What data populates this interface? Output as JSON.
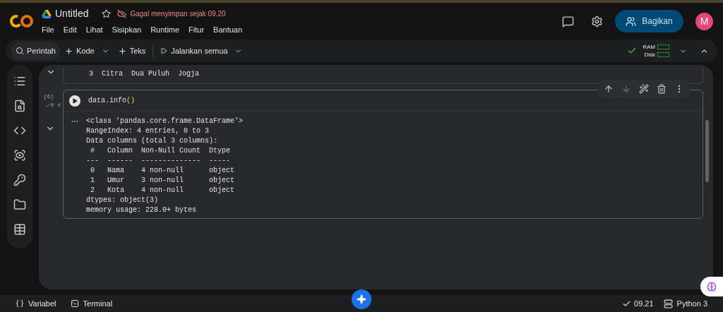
{
  "app": {
    "title": "Untitled",
    "starred": false,
    "save_status": "Gagal menyimpan sejak 09.20"
  },
  "menu": [
    "File",
    "Edit",
    "Lihat",
    "Sisipkan",
    "Runtime",
    "Fitur",
    "Bantuan"
  ],
  "header": {
    "share_button": "Bagikan",
    "avatar": "M"
  },
  "toolbar": {
    "search": "Perintah",
    "add_code": "Kode",
    "add_text": "Teks",
    "run_all": "Jalankan semua",
    "connected": true,
    "ram_label": "RAM",
    "disk_label": "Disk"
  },
  "cells": [
    {
      "kind": "output_tail",
      "output_lines": [
        "3  Citra  Dua Puluh  Jogja"
      ]
    },
    {
      "kind": "code",
      "execution_count": "[6]",
      "status": "0 d",
      "succeeded": true,
      "code_tokens": [
        {
          "kind": "plain",
          "text": "data.info"
        },
        {
          "kind": "paren",
          "text": "()"
        }
      ],
      "output_lines": [
        "<class 'pandas.core.frame.DataFrame'>",
        "RangeIndex: 4 entries, 0 to 3",
        "Data columns (total 3 columns):",
        " #   Column  Non-Null Count  Dtype ",
        "---  ------  --------------  ----- ",
        " 0   Nama    4 non-null      object",
        " 1   Umur    3 non-null      object",
        " 2   Kota    4 non-null      object",
        "dtypes: object(3)",
        "memory usage: 228.0+ bytes"
      ]
    }
  ],
  "status_bar": {
    "variables": "Variabel",
    "terminal": "Terminal",
    "last_run": "09.21",
    "runtime": "Python 3"
  }
}
